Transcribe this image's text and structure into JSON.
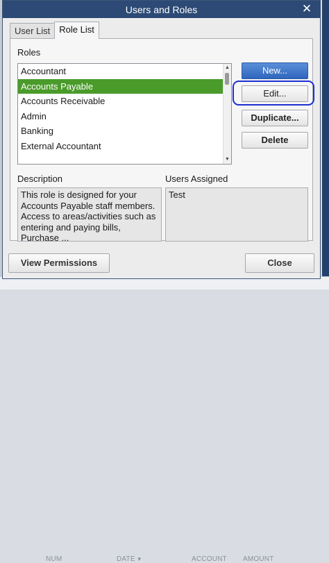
{
  "window": {
    "title": "Users and Roles",
    "close_glyph": "✕"
  },
  "tabs": [
    {
      "label": "User List",
      "active": false
    },
    {
      "label": "Role List",
      "active": true
    }
  ],
  "roles": {
    "label": "Roles",
    "items": [
      {
        "label": "Accountant",
        "selected": false
      },
      {
        "label": "Accounts Payable",
        "selected": true
      },
      {
        "label": "Accounts Receivable",
        "selected": false
      },
      {
        "label": "Admin",
        "selected": false
      },
      {
        "label": "Banking",
        "selected": false
      },
      {
        "label": "External Accountant",
        "selected": false
      }
    ],
    "selected_color": "#4a9b2a"
  },
  "actions": {
    "new_label": "New...",
    "edit_label": "Edit...",
    "duplicate_label": "Duplicate...",
    "delete_label": "Delete"
  },
  "description": {
    "label": "Description",
    "text": "This role is designed for your Accounts Payable staff members. Access to areas/activities such as entering and paying bills, Purchase ..."
  },
  "users_assigned": {
    "label": "Users Assigned",
    "text": "Test"
  },
  "footer": {
    "view_permissions_label": "View Permissions",
    "close_label": "Close"
  },
  "background": {
    "columns": [
      "NUM",
      "DATE",
      "ACCOUNT",
      "AMOUNT"
    ]
  },
  "colors": {
    "titlebar": "#2c4a75",
    "primary_button": "#2f66bd",
    "annotation_ring": "#1b2fd0"
  }
}
